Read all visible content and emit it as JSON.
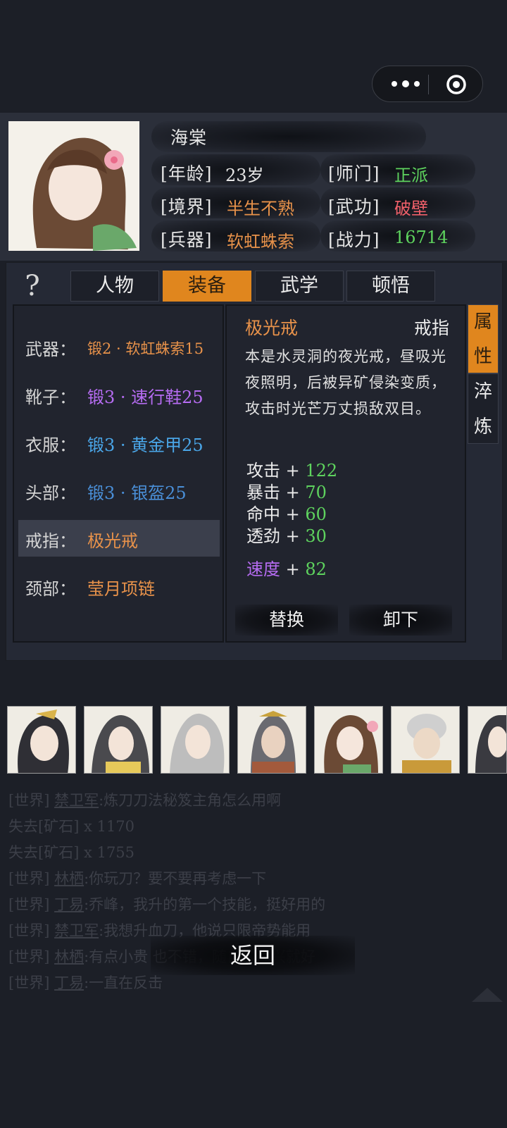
{
  "character": {
    "name": "海棠",
    "age_label": "[年龄]",
    "age_value": "23岁",
    "sect_label": "[师门]",
    "sect_value": "正派",
    "realm_label": "[境界]",
    "realm_value": "半生不熟",
    "martial_label": "[武功]",
    "martial_value": "破壁",
    "weapon_label": "[兵器]",
    "weapon_value": "软虹蛛索",
    "power_label": "[战力]",
    "power_value": "16714"
  },
  "tabs": [
    {
      "label": "人物",
      "active": false
    },
    {
      "label": "装备",
      "active": true
    },
    {
      "label": "武学",
      "active": false
    },
    {
      "label": "顿悟",
      "active": false
    }
  ],
  "help_icon": "question-mark-icon",
  "equipment": [
    {
      "slot": "武器：",
      "item": "锻2 · 软虹蛛索15",
      "color": "#e8924a",
      "selected": false
    },
    {
      "slot": "靴子：",
      "item": "锻3 · 速行鞋25",
      "color": "#b66cf2",
      "selected": false
    },
    {
      "slot": "衣服：",
      "item": "锻3 · 黄金甲25",
      "color": "#4aa6e8",
      "selected": false
    },
    {
      "slot": "头部：",
      "item": "锻3 · 银盔25",
      "color": "#4a8fd8",
      "selected": false
    },
    {
      "slot": "戒指：",
      "item": "极光戒",
      "color": "#e8924a",
      "selected": true
    },
    {
      "slot": "颈部：",
      "item": "莹月项链",
      "color": "#e8924a",
      "selected": false
    }
  ],
  "detail": {
    "name": "极光戒",
    "type": "戒指",
    "description": "本是水灵洞的夜光戒，昼吸光夜照明，后被异矿侵染变质，攻击时光芒万丈损敌双目。",
    "stats": [
      {
        "name": "攻击",
        "plus": "+",
        "value": "122"
      },
      {
        "name": "暴击",
        "plus": "+",
        "value": "70"
      },
      {
        "name": "命中",
        "plus": "+",
        "value": "60"
      },
      {
        "name": "透劲",
        "plus": "+",
        "value": "30"
      }
    ],
    "special_stat": {
      "name": "速度",
      "plus": "+",
      "value": "82"
    },
    "replace_label": "替换",
    "unequip_label": "卸下"
  },
  "side_tabs": [
    {
      "label": "属性",
      "active": true
    },
    {
      "label": "淬炼",
      "active": false
    }
  ],
  "chat": [
    {
      "prefix": "[世界]",
      "user": "禁卫军",
      "text": ":炼刀刀法秘笈主角怎么用啊"
    },
    {
      "prefix": "",
      "user": "",
      "text": "失去[矿石] x 1170"
    },
    {
      "prefix": "",
      "user": "",
      "text": "失去[矿石] x 1755"
    },
    {
      "prefix": "[世界]",
      "user": "林栖",
      "text": ":你玩刀？要不要再考虑一下"
    },
    {
      "prefix": "[世界]",
      "user": "丁易",
      "text": ":乔峰，我升的第一个技能，挺好用的"
    },
    {
      "prefix": "[世界]",
      "user": "禁卫军",
      "text": ":我想升血刀，他说只限帝势能用"
    },
    {
      "prefix": "[世界]",
      "user": "林栖",
      "text": ":有点小贵             也不错，随自己高兴就好"
    },
    {
      "prefix": "[世界]",
      "user": "丁易",
      "text": ":一直在反击"
    }
  ],
  "back_label": "返回",
  "colors": {
    "accent": "#e0861e",
    "green": "#5ed35e",
    "orange": "#e8924a",
    "purple": "#b66cf2",
    "blue": "#4aa6e8",
    "red": "#f0606a"
  }
}
